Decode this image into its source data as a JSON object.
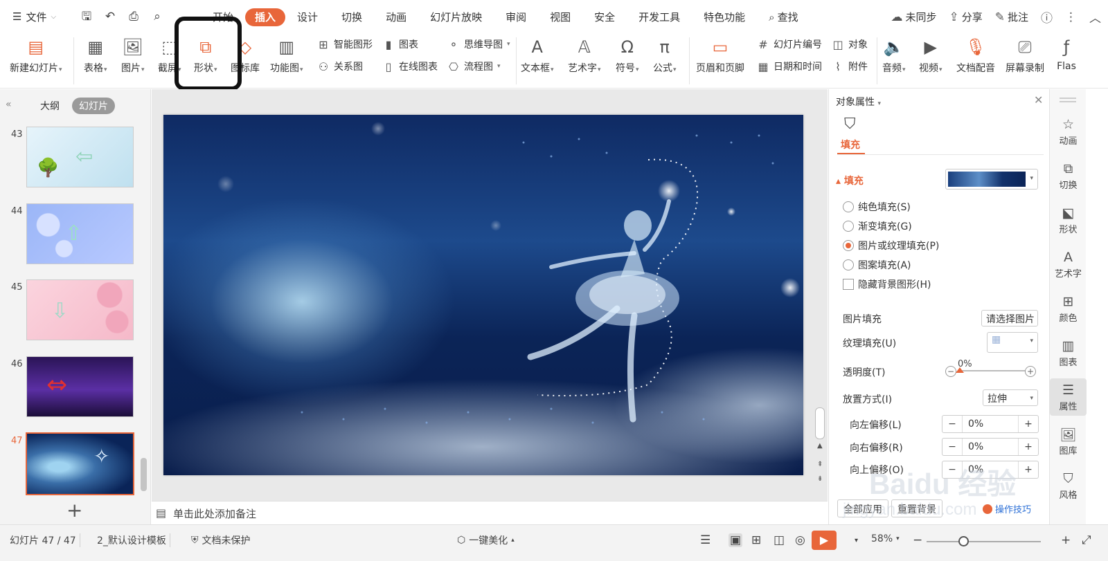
{
  "menubar": {
    "file_label": "文件",
    "tabs": [
      "开始",
      "插入",
      "设计",
      "切换",
      "动画",
      "幻灯片放映",
      "审阅",
      "视图",
      "安全",
      "开发工具",
      "特色功能"
    ],
    "search_label": "查找",
    "sync_label": "未同步",
    "share_label": "分享",
    "comment_label": "批注"
  },
  "ribbon": {
    "new_slide": "新建幻灯片",
    "table": "表格",
    "picture": "图片",
    "screenshot": "截屏",
    "shape": "形状",
    "icon_lib": "图标库",
    "function_chart": "功能图",
    "smart_graphic": "智能图形",
    "chart": "图表",
    "mind_map": "思维导图",
    "relation": "关系图",
    "online_chart": "在线图表",
    "flowchart": "流程图",
    "textbox": "文本框",
    "wordart": "艺术字",
    "symbol": "符号",
    "formula": "公式",
    "header_footer": "页眉和页脚",
    "slide_number": "幻灯片编号",
    "object": "对象",
    "date_time": "日期和时间",
    "attachment": "附件",
    "audio": "音频",
    "video": "视频",
    "doc_dub": "文档配音",
    "screen_rec": "屏幕录制",
    "flash": "Flas"
  },
  "left_panel": {
    "tab_outline": "大纲",
    "tab_slides": "幻灯片",
    "slides": [
      {
        "num": "43"
      },
      {
        "num": "44"
      },
      {
        "num": "45"
      },
      {
        "num": "46"
      },
      {
        "num": "47"
      }
    ]
  },
  "notes_placeholder": "单击此处添加备注",
  "props": {
    "title": "对象属性",
    "fill_tab": "填充",
    "fill_section": "填充",
    "options": [
      "纯色填充(S)",
      "渐变填充(G)",
      "图片或纹理填充(P)",
      "图案填充(A)"
    ],
    "selected_option": "图片或纹理填充(P)",
    "hide_bg": "隐藏背景图形(H)",
    "picture_fill_label": "图片填充",
    "picture_fill_btn": "请选择图片",
    "texture_fill_label": "纹理填充(U)",
    "transparency_label": "透明度(T)",
    "transparency_value": "0%",
    "placement_label": "放置方式(I)",
    "placement_value": "拉伸",
    "offset_left_label": "向左偏移(L)",
    "offset_left_value": "0%",
    "offset_right_label": "向右偏移(R)",
    "offset_right_value": "0%",
    "offset_up_label": "向上偏移(O)",
    "offset_up_value": "0%",
    "apply_all": "全部应用",
    "reset_bg": "重置背景",
    "tips": "操作技巧"
  },
  "sidebar": [
    "动画",
    "切换",
    "形状",
    "艺术字",
    "颜色",
    "图表",
    "属性",
    "图库",
    "风格"
  ],
  "status": {
    "slide_count": "幻灯片 47 / 47",
    "template": "2_默认设计模板",
    "protect": "文档未保护",
    "beautify": "一键美化",
    "zoom": "58%"
  },
  "watermark": {
    "brand": "Baidu 经验",
    "url": "jingyan.baidu.com"
  },
  "colors": {
    "accent": "#e8663a"
  }
}
